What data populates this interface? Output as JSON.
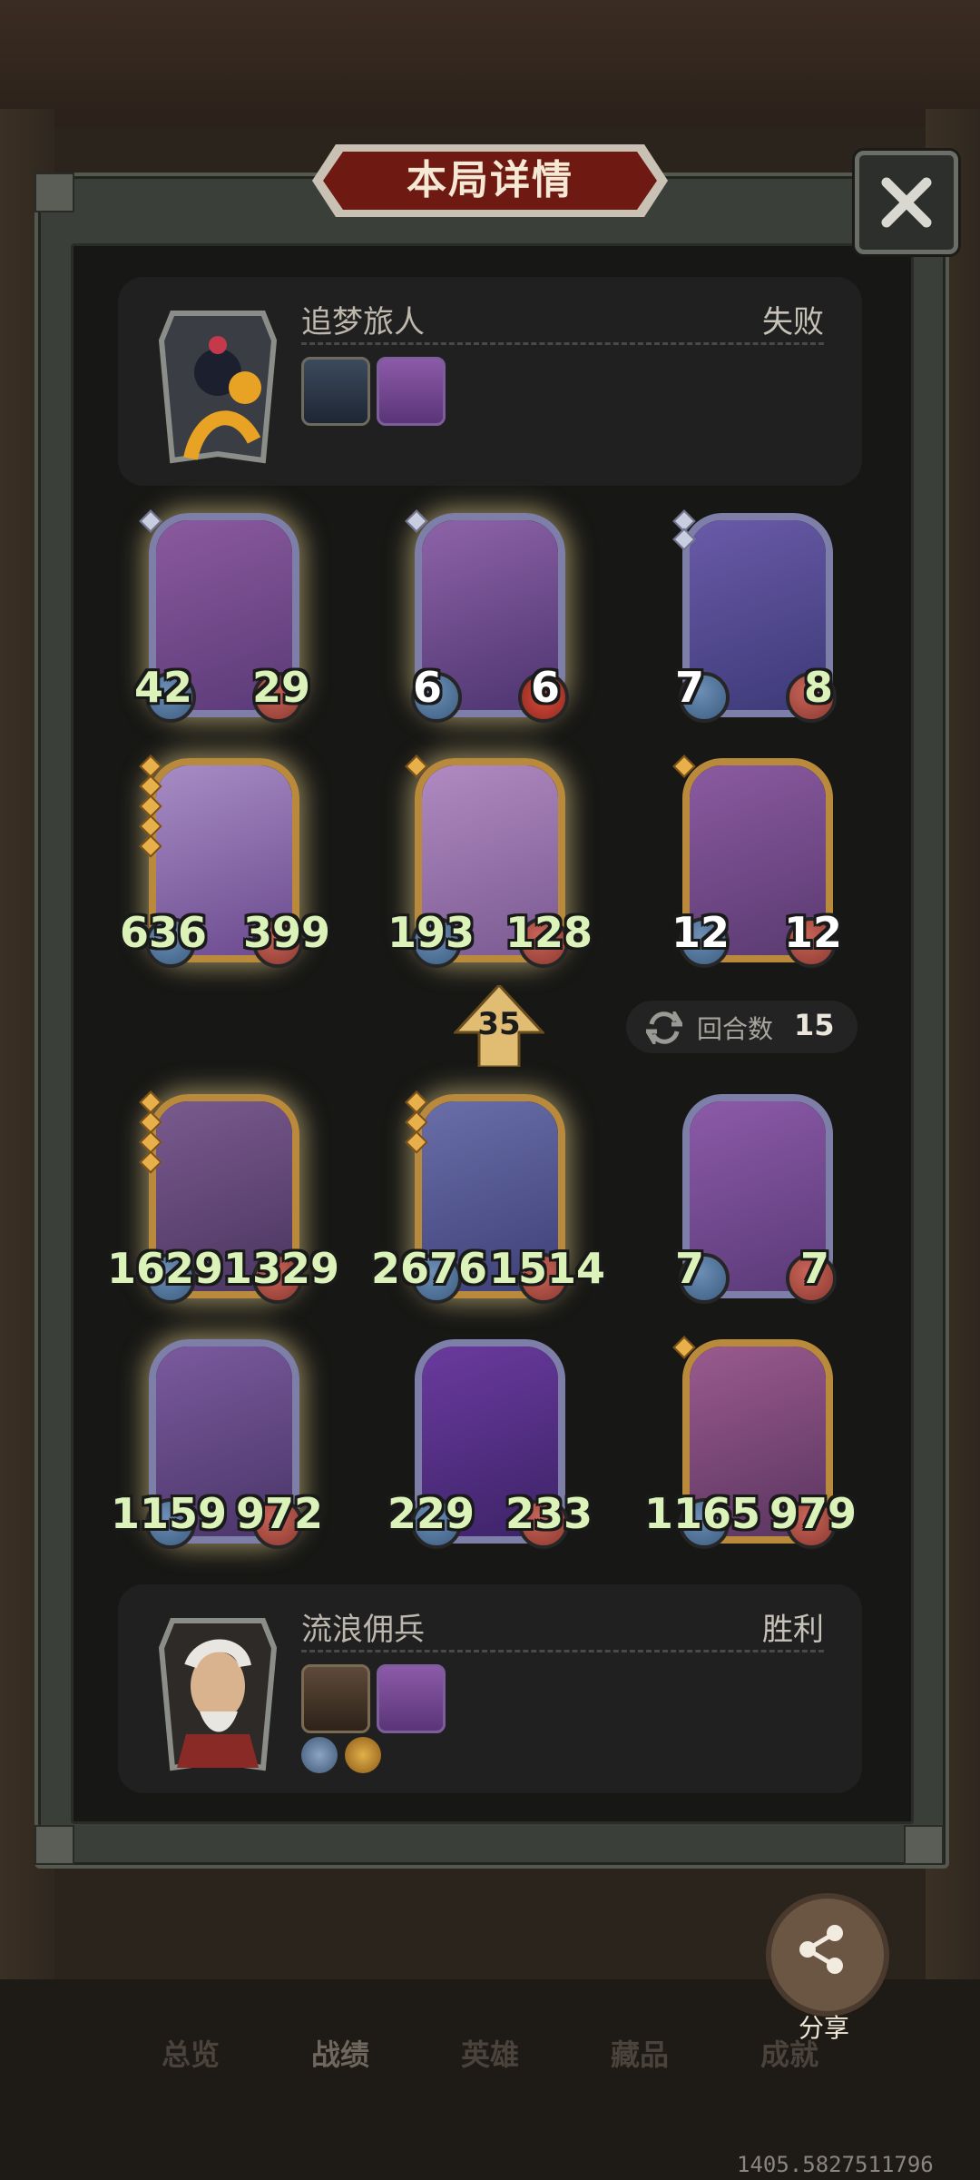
{
  "header": {
    "title": "本局详情",
    "close_icon": "close-icon"
  },
  "opponent": {
    "name": "追梦旅人",
    "result": "失败",
    "items": [
      "shadow-creature-item",
      "jewel-chest-item"
    ]
  },
  "player": {
    "name": "流浪佣兵",
    "result": "胜利",
    "items": [
      "fire-lantern-item",
      "jewel-chest-item"
    ],
    "chips": [
      "sword-chip-icon",
      "gold-ring-chip-icon"
    ]
  },
  "opponent_cards": [
    {
      "attack": "42",
      "health": "29",
      "frame": "silver",
      "stars": 1,
      "glow": true
    },
    {
      "attack": "6",
      "health": "6",
      "frame": "silver",
      "stars": 1,
      "glow": true
    },
    {
      "attack": "7",
      "health": "8",
      "frame": "silver",
      "stars": 2,
      "glow": false
    },
    {
      "attack": "636",
      "health": "399",
      "frame": "gold",
      "stars": 5,
      "glow": true
    },
    {
      "attack": "193",
      "health": "128",
      "frame": "gold",
      "stars": 1,
      "glow": true
    },
    {
      "attack": "12",
      "health": "12",
      "frame": "gold",
      "stars": 1,
      "glow": false
    }
  ],
  "player_cards": [
    {
      "attack": "1629",
      "health": "1329",
      "frame": "gold",
      "stars": 4,
      "glow": true
    },
    {
      "attack": "2676",
      "health": "1514",
      "frame": "gold",
      "stars": 3,
      "glow": true
    },
    {
      "attack": "7",
      "health": "7",
      "frame": "silver",
      "stars": 0,
      "glow": false
    },
    {
      "attack": "1159",
      "health": "972",
      "frame": "silver",
      "stars": 0,
      "glow": true
    },
    {
      "attack": "229",
      "health": "233",
      "frame": "silver",
      "stars": 0,
      "glow": false
    },
    {
      "attack": "1165",
      "health": "979",
      "frame": "gold",
      "stars": 1,
      "glow": false
    }
  ],
  "middle": {
    "level": "35",
    "rounds_label": "回合数",
    "rounds_value": "15"
  },
  "share": {
    "label": "分享"
  },
  "tabs": [
    "总览",
    "战绩",
    "英雄",
    "藏品",
    "成就"
  ],
  "active_tab": "战绩",
  "footer_text": "1405.5827511796",
  "colors": {
    "stat_green": "#dbf3b8",
    "frame_gold": "#b98a3c",
    "frame_silver": "#7d7fa8",
    "title_red": "#6e1a12"
  }
}
